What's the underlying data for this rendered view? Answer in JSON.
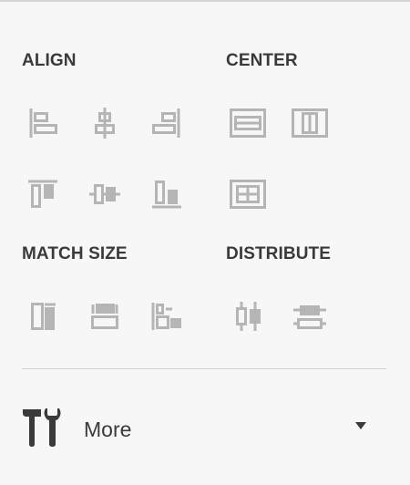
{
  "sections": {
    "align": {
      "title": "ALIGN"
    },
    "center": {
      "title": "CENTER"
    },
    "match_size": {
      "title": "MATCH SIZE"
    },
    "distribute": {
      "title": "DISTRIBUTE"
    }
  },
  "more": {
    "label": "More",
    "icon": "tools-icon",
    "caret": "caret-down-icon"
  },
  "colors": {
    "background": "#f7f7f7",
    "icon": "#b5b5b5",
    "text": "#3a3a3a",
    "divider": "#cfcfcf"
  },
  "icons": [
    "align-left-icon",
    "align-horizontal-center-icon",
    "align-right-icon",
    "align-top-icon",
    "align-vertical-center-icon",
    "align-bottom-icon",
    "center-horizontal-icon",
    "center-vertical-icon",
    "center-both-icon",
    "match-width-icon",
    "match-height-icon",
    "match-size-icon",
    "distribute-horizontal-icon",
    "distribute-vertical-icon"
  ]
}
